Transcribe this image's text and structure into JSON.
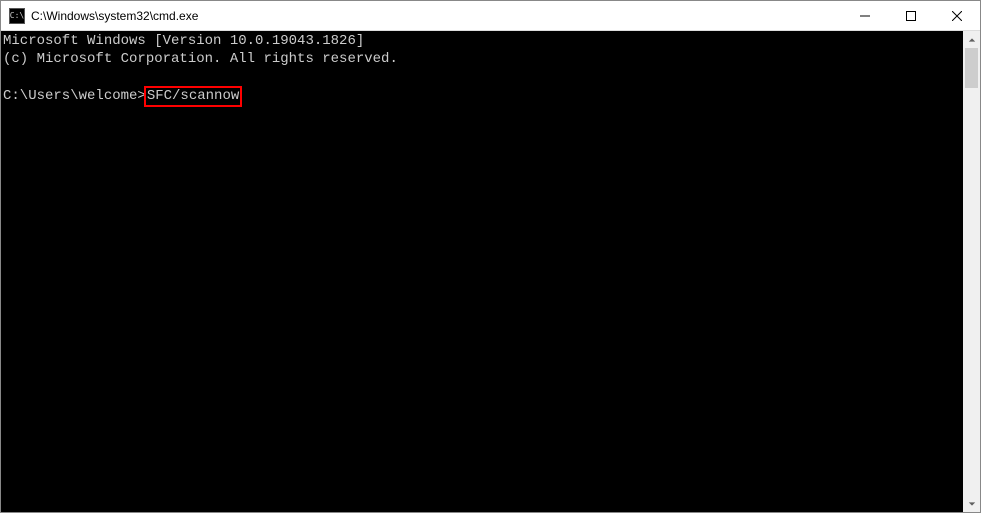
{
  "titlebar": {
    "icon_label": "C:\\",
    "title": "C:\\Windows\\system32\\cmd.exe"
  },
  "terminal": {
    "line1": "Microsoft Windows [Version 10.0.19043.1826]",
    "line2": "(c) Microsoft Corporation. All rights reserved.",
    "blank": "",
    "prompt": "C:\\Users\\welcome>",
    "command": "SFC/scannow"
  }
}
